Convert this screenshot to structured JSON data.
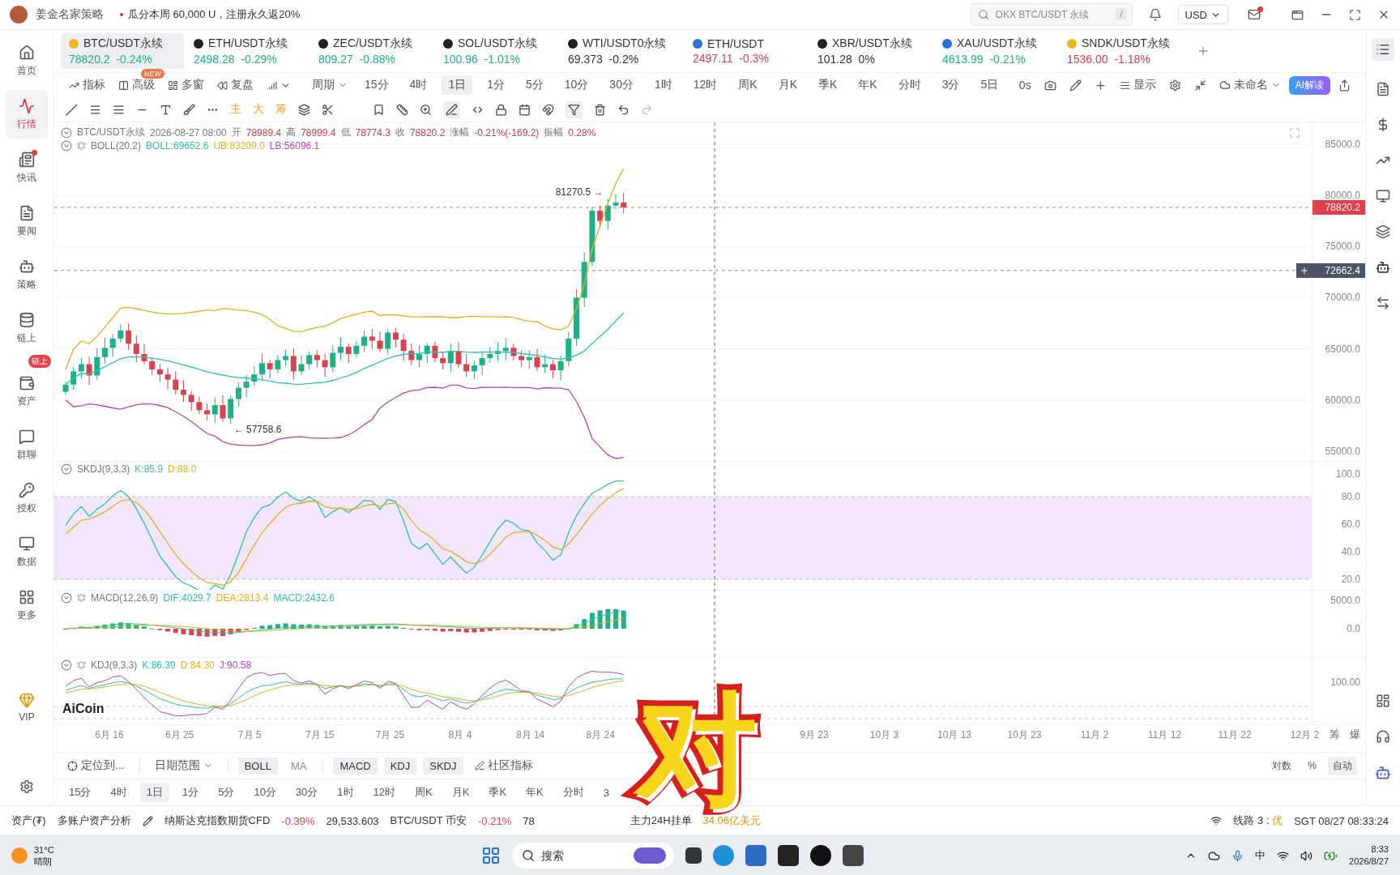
{
  "title_bar": {
    "app_name": "姜金名家策略",
    "promo": "瓜分本周 60,000 U，注册永久返20%",
    "search": {
      "placeholder": "OKX BTC/USDT 永续",
      "shortcut": "/"
    },
    "currency": "USD",
    "mail_unread": true
  },
  "sidebar": {
    "items": [
      {
        "label": "首页",
        "kind": "home",
        "selected": false,
        "dot": false
      },
      {
        "label": "行情",
        "kind": "market",
        "selected": true,
        "dot": false
      },
      {
        "label": "快讯",
        "kind": "news",
        "selected": false,
        "dot": true
      },
      {
        "label": "要闻",
        "kind": "article",
        "selected": false,
        "dot": false
      },
      {
        "label": "策略",
        "kind": "bot",
        "selected": false,
        "dot": false
      },
      {
        "label": "链上",
        "kind": "chain",
        "selected": false,
        "dot": false
      },
      {
        "label": "资产",
        "kind": "wallet",
        "selected": false,
        "dot": false,
        "badge": "链上"
      },
      {
        "label": "群聊",
        "kind": "chat",
        "selected": false,
        "dot": false
      },
      {
        "label": "授权",
        "kind": "key",
        "selected": false,
        "dot": false
      },
      {
        "label": "数据",
        "kind": "data",
        "selected": false,
        "dot": false
      },
      {
        "label": "更多",
        "kind": "more",
        "selected": false,
        "dot": false
      },
      {
        "label": "VIP",
        "kind": "vip",
        "selected": false,
        "dot": false
      }
    ]
  },
  "tickers": [
    {
      "symbol": "BTC/USDT永续",
      "price": "78820.2",
      "change": "-0.24%",
      "color": "#1fb08a",
      "selected": true
    },
    {
      "symbol": "ETH/USDT永续",
      "price": "2498.28",
      "change": "-0.29%",
      "color": "#1fb08a",
      "selected": false
    },
    {
      "symbol": "ZEC/USDT永续",
      "price": "809.27",
      "change": "-0.88%",
      "color": "#1fb08a",
      "selected": false
    },
    {
      "symbol": "SOL/USDT永续",
      "price": "100.96",
      "change": "-1.01%",
      "color": "#1fb08a",
      "selected": false
    },
    {
      "symbol": "WTI/USDT0永续",
      "price": "69.373",
      "change": "-0.2%",
      "color": "#333333",
      "selected": false
    },
    {
      "symbol": "ETH/USDT",
      "price": "2497.11",
      "change": "-0.3%",
      "color": "#c8424f",
      "selected": false
    },
    {
      "symbol": "XBR/USDT永续",
      "price": "101.28",
      "change": "0%",
      "color": "#333333",
      "selected": false
    },
    {
      "symbol": "XAU/USDT永续",
      "price": "4613.99",
      "change": "-0.21%",
      "color": "#1fb08a",
      "selected": false
    },
    {
      "symbol": "SNDK/USDT永续",
      "price": "1536.00",
      "change": "-1.18%",
      "color": "#c8424f",
      "selected": false
    }
  ],
  "period_toolbar": {
    "tools": [
      {
        "label": "指标"
      },
      {
        "label": "高级",
        "badge": "NEW"
      },
      {
        "label": "多窗"
      },
      {
        "label": "复盘"
      }
    ],
    "period_label": "周期",
    "periods": [
      {
        "label": "15分",
        "selected": false
      },
      {
        "label": "4时",
        "selected": false
      },
      {
        "label": "1日",
        "selected": true
      },
      {
        "label": "1分",
        "selected": false
      },
      {
        "label": "5分",
        "selected": false
      },
      {
        "label": "10分",
        "selected": false
      },
      {
        "label": "30分",
        "selected": false
      },
      {
        "label": "1时",
        "selected": false
      },
      {
        "label": "12时",
        "selected": false
      },
      {
        "label": "周K",
        "selected": false
      },
      {
        "label": "月K",
        "selected": false
      },
      {
        "label": "季K",
        "selected": false
      },
      {
        "label": "年K",
        "selected": false
      },
      {
        "label": "分时",
        "selected": false
      },
      {
        "label": "3分",
        "selected": false
      },
      {
        "label": "5日",
        "selected": false
      }
    ],
    "refresh": "0s",
    "display": "显示",
    "layout_name": "未命名",
    "ai_button": "AI解读"
  },
  "drawing_toolbar": {
    "text_tools": [
      "主",
      "大",
      "筹"
    ]
  },
  "chart": {
    "legend": {
      "symbol": "BTC/USDT永续",
      "time": "2026-08-27 08:00",
      "items": [
        {
          "label": "开",
          "value": "78989.4"
        },
        {
          "label": "高",
          "value": "78999.4"
        },
        {
          "label": "低",
          "value": "78774.3"
        },
        {
          "label": "收",
          "value": "78820.2"
        },
        {
          "label": "涨幅",
          "value": "-0.21%(-169.2)"
        },
        {
          "label": "振幅",
          "value": "0.28%"
        }
      ]
    },
    "indicators": [
      {
        "name": "BOLL(20,2)",
        "alert": true,
        "values": [
          {
            "text": "BOLL:69652.6",
            "color": "#2fc0b0"
          },
          {
            "text": "UB:83209.0",
            "color": "#e0b020"
          },
          {
            "text": "LB:56096.1",
            "color": "#b048b0"
          }
        ]
      },
      {
        "name": "SKDJ(9,3,3)",
        "alert": false,
        "values": [
          {
            "text": "K:85.9",
            "color": "#2fc0b0"
          },
          {
            "text": "D:88.0",
            "color": "#e0b020"
          }
        ]
      },
      {
        "name": "MACD(12,26,9)",
        "alert": true,
        "values": [
          {
            "text": "DIF:4029.7",
            "color": "#2fc0b0"
          },
          {
            "text": "DEA:2813.4",
            "color": "#e0b020"
          },
          {
            "text": "MACD:2432.6",
            "color": "#2fc0b0"
          }
        ]
      },
      {
        "name": "KDJ(9,3,3)",
        "alert": true,
        "values": [
          {
            "text": "K:86.39",
            "color": "#2fc0b0"
          },
          {
            "text": "D:84.30",
            "color": "#e0b020"
          },
          {
            "text": "J:90.58",
            "color": "#b048b0"
          }
        ]
      }
    ],
    "high_marker": "81270.5 →",
    "low_marker": "← 57758.6",
    "watermark": "AiCoin",
    "price_axis": [
      "85000.0",
      "80000.0",
      "75000.0",
      "70000.0",
      "65000.0",
      "60000.0",
      "55000.0"
    ],
    "last_price": "78820.2",
    "crosshair_price": "72662.4",
    "skdj_axis": [
      "100.0",
      "80.0",
      "60.0",
      "40.0",
      "20.0"
    ],
    "macd_axis": [
      "5000.0",
      "0.0"
    ],
    "kdj_axis": [
      "100.00"
    ],
    "x_axis": [
      "6月 16",
      "6月 25",
      "7月 5",
      "7月 15",
      "7月 25",
      "8月 4",
      "8月 14",
      "8月 24",
      "9月 23",
      "10月 3",
      "10月 13",
      "10月 23",
      "11月 2",
      "11月 12",
      "11月 22",
      "12月 2"
    ],
    "x_axis_tools": [
      "筹",
      "爆"
    ]
  },
  "bottom_toolbar": {
    "goto": "定位到...",
    "date_range": "日期范围",
    "main_indicators": [
      {
        "label": "BOLL",
        "selected": true
      },
      {
        "label": "MA",
        "selected": false
      }
    ],
    "sub_indicators": [
      {
        "label": "MACD",
        "selected": true
      },
      {
        "label": "KDJ",
        "selected": true
      },
      {
        "label": "SKDJ",
        "selected": true
      }
    ],
    "community": "社区指标",
    "scale_options": [
      {
        "label": "对数",
        "selected": false
      },
      {
        "label": "%",
        "selected": false
      },
      {
        "label": "自动",
        "selected": true
      }
    ]
  },
  "bottom_periods": [
    {
      "label": "15分",
      "selected": false
    },
    {
      "label": "4时",
      "selected": false
    },
    {
      "label": "1日",
      "selected": true
    },
    {
      "label": "1分",
      "selected": false
    },
    {
      "label": "5分",
      "selected": false
    },
    {
      "label": "10分",
      "selected": false
    },
    {
      "label": "30分",
      "selected": false
    },
    {
      "label": "1时",
      "selected": false
    },
    {
      "label": "12时",
      "selected": false
    },
    {
      "label": "周K",
      "selected": false
    },
    {
      "label": "月K",
      "selected": false
    },
    {
      "label": "季K",
      "selected": false
    },
    {
      "label": "年K",
      "selected": false
    },
    {
      "label": "分时",
      "selected": false
    },
    {
      "label": "3",
      "selected": false
    }
  ],
  "status_bar": {
    "assets": "资产(₮)",
    "analysis": "多账户资产分析",
    "quotes": [
      {
        "name": "纳斯达克指数期货CFD",
        "change": "-0.39%",
        "price": "29,533.603"
      },
      {
        "name": "BTC/USDT 币安",
        "change": "-0.21%",
        "price": "78"
      }
    ],
    "orderbook_label": "主力24H挂单",
    "orderbook_value": "34.06亿美元",
    "line_label": "线路 3 : ",
    "line_quality": "优",
    "clock": "SGT 08/27 08:33:24"
  },
  "overlay": {
    "text": "对"
  },
  "taskbar": {
    "temperature": "31°C",
    "weather": "晴朗",
    "search_placeholder": "搜索",
    "ime": "中",
    "time": "8:33",
    "date": "2026/8/27"
  }
}
